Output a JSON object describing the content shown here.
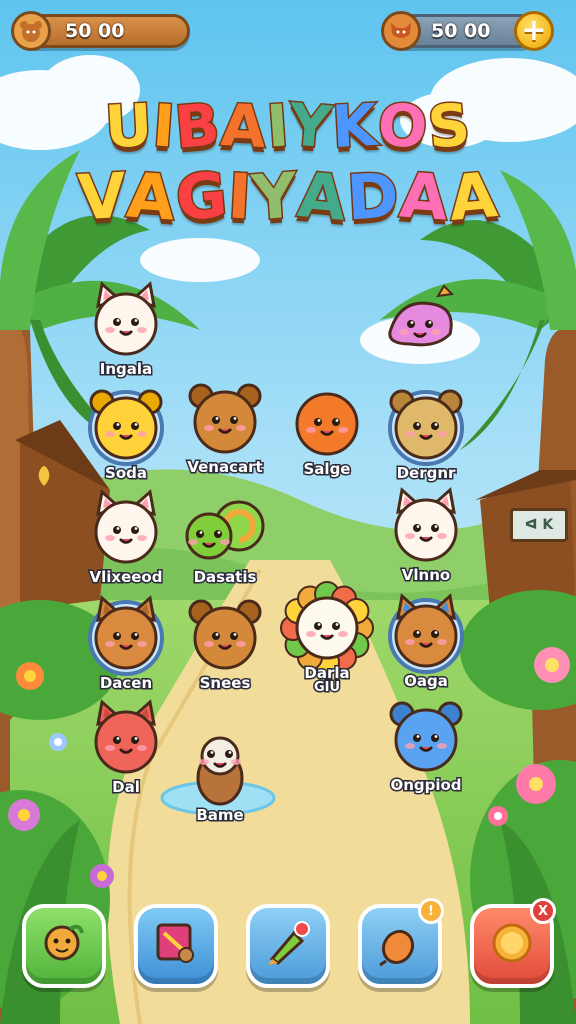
{
  "hud": {
    "coins_left": "50 00",
    "coins_right": "50 00",
    "plus_label": "+"
  },
  "title": {
    "line1": [
      "U",
      "I",
      "B",
      "A",
      "I",
      "Y",
      "K",
      "O",
      "S"
    ],
    "line2": [
      "V",
      "A",
      "G",
      "I",
      "Y",
      "A",
      "D",
      "A",
      "A"
    ],
    "colors": [
      "#ffd43b",
      "#ff9f1c",
      "#f94144",
      "#f3722c",
      "#90be6d",
      "#43aa8b",
      "#4d96ff",
      "#ff6fb5",
      "#ffd43b"
    ]
  },
  "pets": [
    {
      "id": "cat-white",
      "label": "Ingala"
    },
    {
      "id": "pink-blob",
      "label": ""
    },
    {
      "id": "yellow-pup",
      "label": "Soda"
    },
    {
      "id": "brown-bear",
      "label": "Venacart"
    },
    {
      "id": "orange-ball",
      "label": "Salge"
    },
    {
      "id": "tan-hamster",
      "label": "Dergnr"
    },
    {
      "id": "cat-white-2",
      "label": "Vlixeeod"
    },
    {
      "id": "green-snail",
      "label": "Dasatis"
    },
    {
      "id": "cat-white-3",
      "label": "Vlnno"
    },
    {
      "id": "tabby-cat",
      "label": "Dacen"
    },
    {
      "id": "brown-bear-2",
      "label": "Snees"
    },
    {
      "id": "lion-flower",
      "label": "Darla",
      "sublabel": "GIU"
    },
    {
      "id": "tabby-cat-2",
      "label": "Oaga"
    },
    {
      "id": "red-cat",
      "label": "Dal"
    },
    {
      "id": "hamster-pond",
      "label": "Bame"
    },
    {
      "id": "blue-bear",
      "label": "Ongpiod"
    }
  ],
  "sign": {
    "text": "ᐊ K"
  },
  "nav": {
    "buttons": [
      {
        "id": "pets",
        "badge": ""
      },
      {
        "id": "book",
        "badge": ""
      },
      {
        "id": "brush",
        "badge": ""
      },
      {
        "id": "food",
        "badge": "!"
      },
      {
        "id": "shop",
        "badge": "X"
      }
    ]
  }
}
